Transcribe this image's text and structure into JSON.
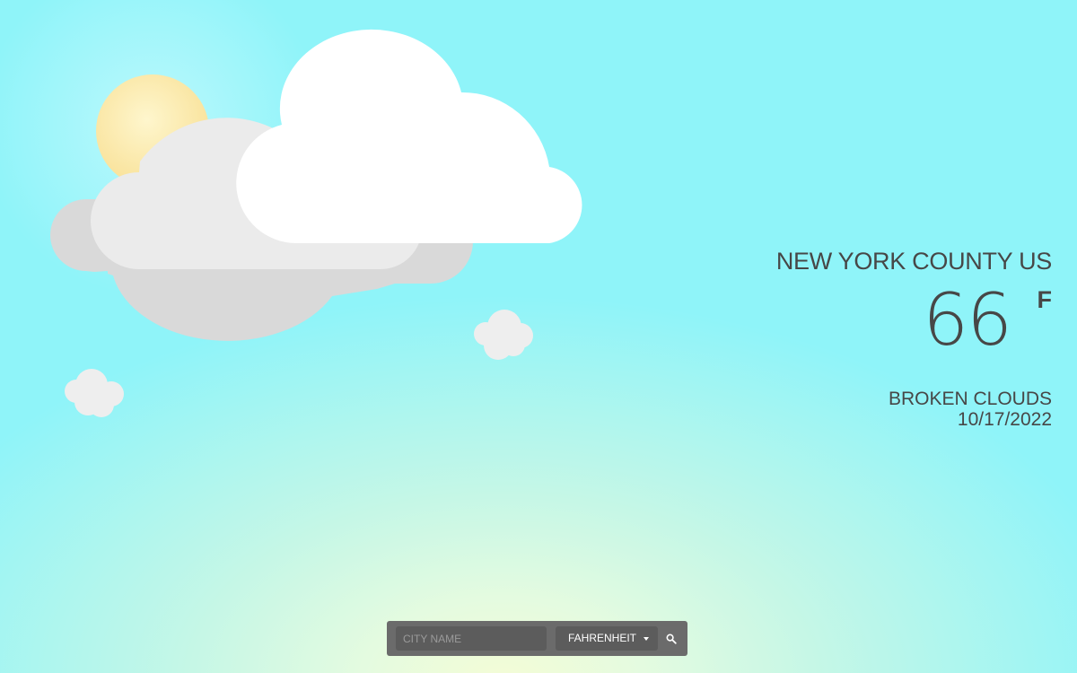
{
  "weather": {
    "location": "NEW YORK COUNTY US",
    "temperature": "66",
    "unit_symbol": "F",
    "condition": "BROKEN CLOUDS",
    "date": "10/17/2022",
    "icon": "sun-behind-clouds-icon"
  },
  "search": {
    "placeholder": "CITY NAME",
    "value": "",
    "unit_selected": "FAHRENHEIT",
    "button_icon": "search-icon"
  },
  "colors": {
    "sky": "#8ff4f9",
    "horizon_glow": "#f4fcd6",
    "sun": "#fbe59a",
    "cloud_white": "#ffffff",
    "cloud_light_gray": "#ececec",
    "cloud_gray": "#d9d9d9",
    "text": "#474747",
    "search_bar": "#6b6b6b"
  }
}
